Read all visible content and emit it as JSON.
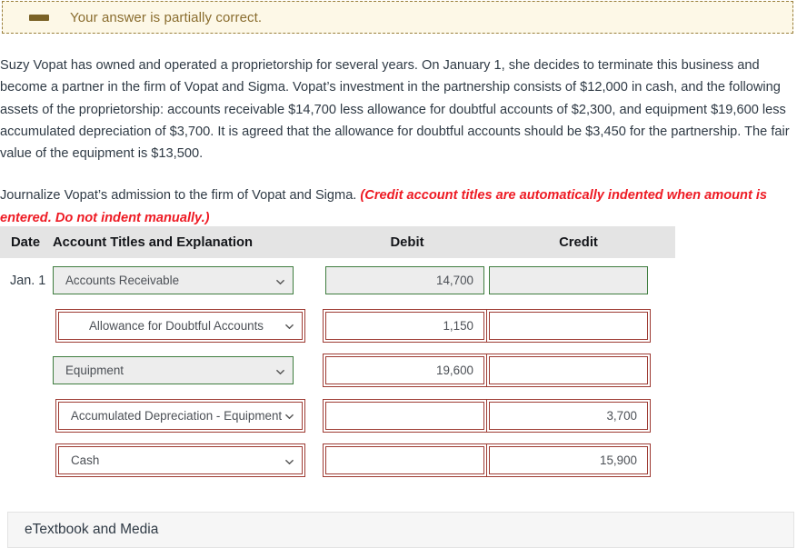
{
  "alert": {
    "icon": "minus-dash-icon",
    "message": "Your answer is partially correct."
  },
  "problem": {
    "paragraph": "Suzy Vopat has owned and operated a proprietorship for several years. On January 1, she decides to terminate this business and become a partner in the firm of Vopat and Sigma. Vopat’s investment in the partnership consists of $12,000 in cash, and the following assets of the proprietorship: accounts receivable $14,700 less allowance for doubtful accounts of $2,300, and equipment $19,600 less accumulated depreciation of $3,700. It is agreed that the allowance for doubtful accounts should be $3,450 for the partnership. The fair value of the equipment is $13,500.",
    "instruction_plain": "Journalize Vopat’s admission to the firm of Vopat and Sigma. ",
    "instruction_emphasis": "(Credit account titles are automatically indented when amount is entered. Do not indent manually.)"
  },
  "table": {
    "headers": {
      "date": "Date",
      "account": "Account Titles and Explanation",
      "debit": "Debit",
      "credit": "Credit"
    },
    "rows": [
      {
        "date": "Jan. 1",
        "account": "Accounts Receivable",
        "account_state": "correct",
        "debit": "14,700",
        "debit_state": "correct",
        "credit": "",
        "credit_state": "correct",
        "indented": false
      },
      {
        "date": "",
        "account": "Allowance for Doubtful Accounts",
        "account_state": "incorrect",
        "debit": "1,150",
        "debit_state": "incorrect",
        "credit": "",
        "credit_state": "incorrect",
        "indented": true
      },
      {
        "date": "",
        "account": "Equipment",
        "account_state": "correct",
        "debit": "19,600",
        "debit_state": "incorrect",
        "credit": "",
        "credit_state": "incorrect",
        "indented": false
      },
      {
        "date": "",
        "account": "Accumulated Depreciation - Equipment",
        "account_state": "incorrect",
        "debit": "",
        "debit_state": "incorrect",
        "credit": "3,700",
        "credit_state": "incorrect",
        "indented": true
      },
      {
        "date": "",
        "account": "Cash",
        "account_state": "incorrect",
        "debit": "",
        "debit_state": "incorrect",
        "credit": "15,900",
        "credit_state": "incorrect",
        "indented": true
      }
    ]
  },
  "footer": {
    "etextbook_label": "eTextbook and Media"
  },
  "colors": {
    "alert_bg": "#fdf8e7",
    "alert_border": "#9a803d",
    "alert_text": "#8a6d2f",
    "emphasis_red": "#ee1b24",
    "correct_border": "#3f7d3f",
    "incorrect_border": "#9e3b33",
    "header_bg": "#e4e4e4"
  }
}
